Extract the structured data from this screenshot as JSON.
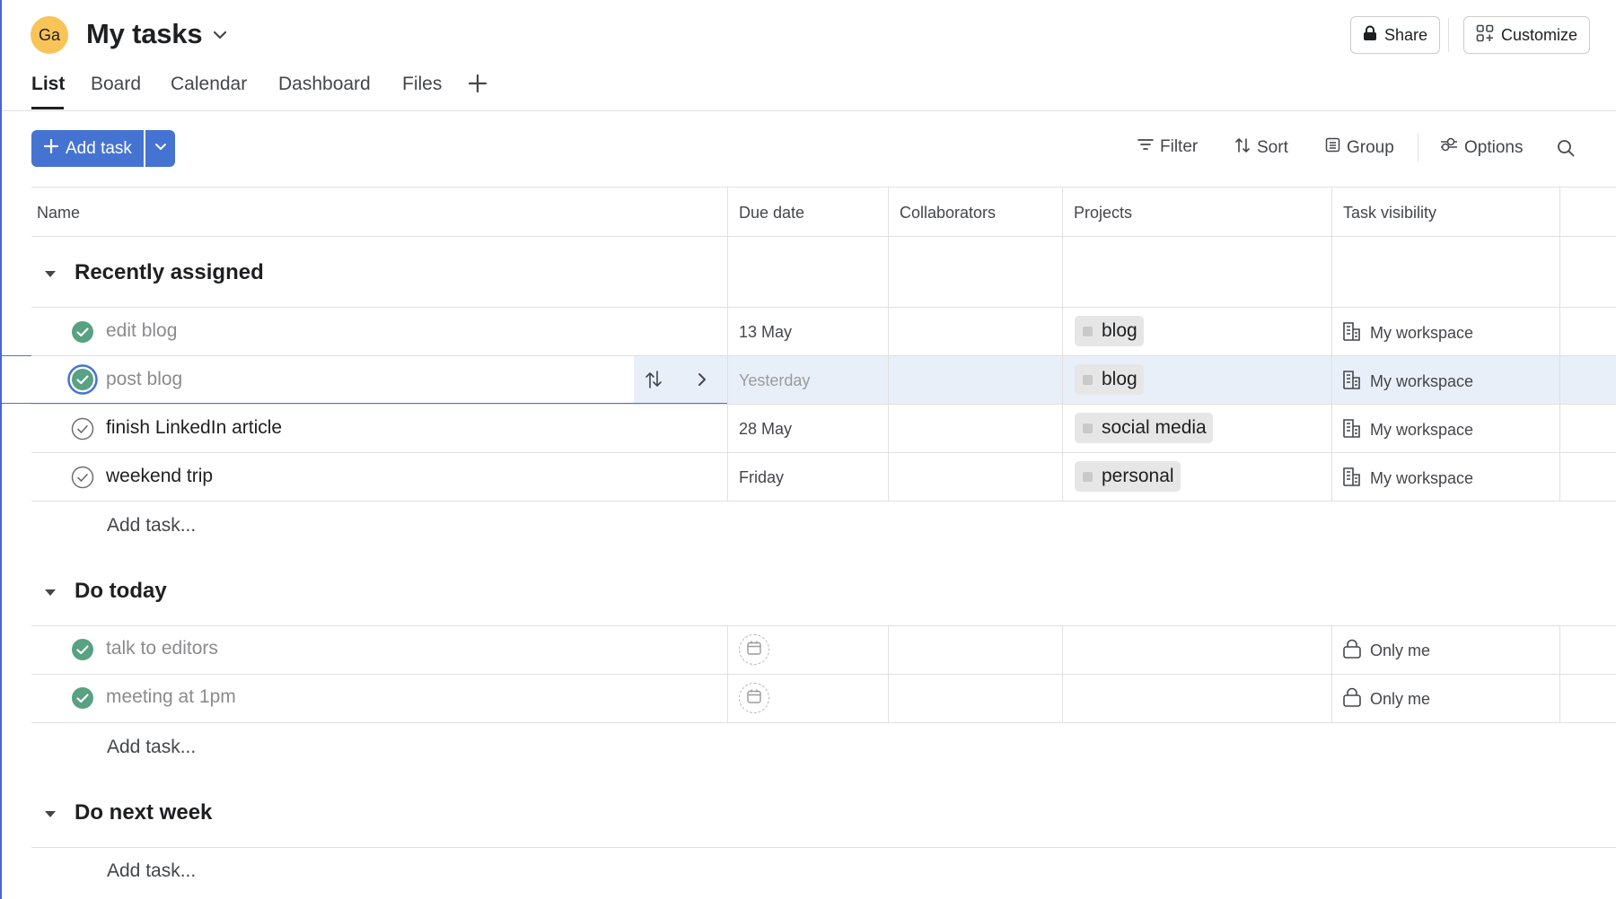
{
  "header": {
    "avatar_initials": "Ga",
    "title": "My tasks",
    "share_label": "Share",
    "customize_label": "Customize"
  },
  "tabs": [
    {
      "label": "List",
      "active": true
    },
    {
      "label": "Board"
    },
    {
      "label": "Calendar"
    },
    {
      "label": "Dashboard"
    },
    {
      "label": "Files"
    }
  ],
  "toolbar": {
    "add_task_label": "Add task",
    "filter_label": "Filter",
    "sort_label": "Sort",
    "group_label": "Group",
    "options_label": "Options"
  },
  "columns": [
    "Name",
    "Due date",
    "Collaborators",
    "Projects",
    "Task visibility"
  ],
  "sections": [
    {
      "title": "Recently assigned",
      "tasks": [
        {
          "name": "edit blog",
          "completed": true,
          "due": "13 May",
          "project": "blog",
          "visibility": "My workspace"
        },
        {
          "name": "post blog",
          "completed": true,
          "selected": true,
          "due": "Yesterday",
          "project": "blog",
          "visibility": "My workspace"
        },
        {
          "name": "finish LinkedIn article",
          "completed": false,
          "due": "28 May",
          "project": "social media",
          "visibility": "My workspace"
        },
        {
          "name": "weekend trip",
          "completed": false,
          "due": "Friday",
          "project": "personal",
          "visibility": "My workspace"
        }
      ],
      "add_task_label": "Add task..."
    },
    {
      "title": "Do today",
      "tasks": [
        {
          "name": "talk to editors",
          "completed": true,
          "due": "",
          "project": "",
          "visibility": "Only me"
        },
        {
          "name": "meeting at 1pm",
          "completed": true,
          "due": "",
          "project": "",
          "visibility": "Only me"
        }
      ],
      "add_task_label": "Add task..."
    },
    {
      "title": "Do next week",
      "tasks": [],
      "add_task_label": "Add task..."
    }
  ],
  "colors": {
    "accent": "#4573d2",
    "complete_green": "#58a182",
    "avatar": "#f8c458",
    "selected_row": "#e9eff9"
  }
}
